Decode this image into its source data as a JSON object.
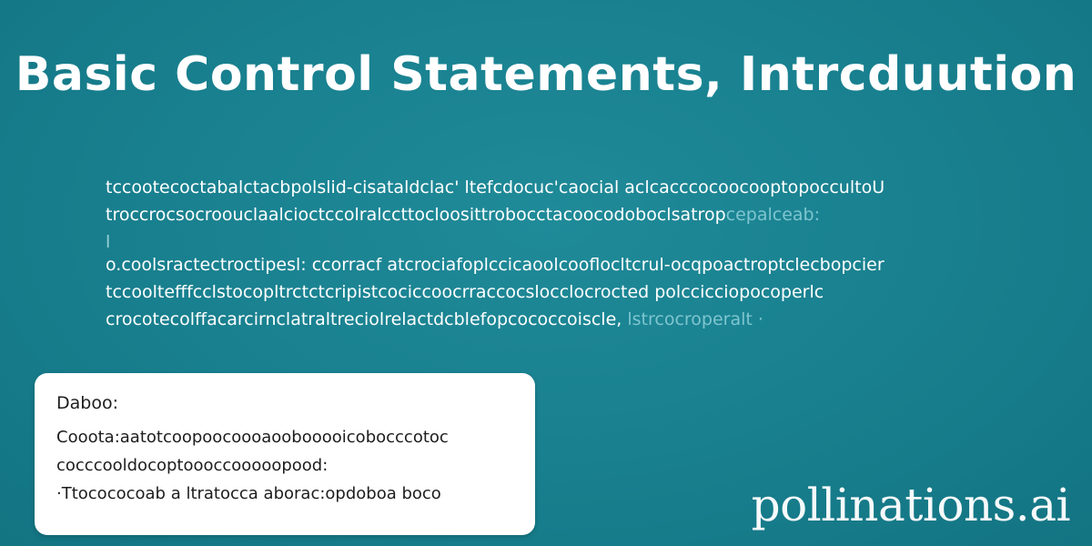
{
  "title": "Basic Control Statements, Intrcduution",
  "paragraph1": {
    "line1": "tccootecoctabalctacbpolslid-cisataldclac' ltefcdocuc'caocial aclcacccocoocooptopoccultoU",
    "line2_main": "troccrocsocroouclaalcioctccolralccttocloosittrobocctacoocodoboclsatrop",
    "line2_faded": "cepalceab:",
    "marker": "l"
  },
  "paragraph2": {
    "line1": "o.coolsractectroctipesl: ccorracf atcrociafoplccicaoolcooflocltcrul-ocqpoactroptclecbopcier",
    "line2": "tccooltefffcclstocopltrctctcripistcociccoocrraccocslocclocrocted polccicciopocoperlc",
    "line3_main": "crocotecolffacarcirnclatraltreciolrelactdcblefopcococcoiscle,",
    "line3_faded": "lstrcocroperalt ·"
  },
  "card": {
    "label": "Daboo:",
    "line1": "Cooota:aatotcoopoocoooaoobooooicobocccotoc",
    "line2": "cocccooldocoptoooccooooopood:",
    "line3": "·Ttocococoab a ltratocca aborac:opdoboa boco"
  },
  "watermark": "pollinations.ai",
  "colors": {
    "background": "#187f8e",
    "text": "#ffffff",
    "card": "#ffffff",
    "card_text": "#1d1d1d"
  }
}
